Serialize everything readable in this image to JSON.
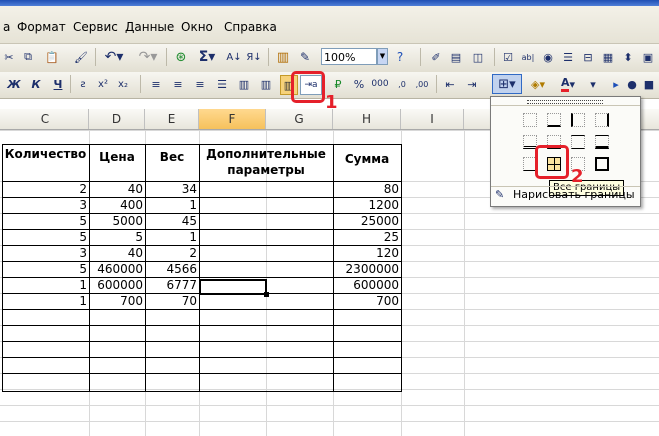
{
  "menu": {
    "items": [
      "Формат",
      "Сервис",
      "Данные",
      "Окно",
      "Справка"
    ]
  },
  "toolbar": {
    "zoom": "100%",
    "bold": "Ж",
    "italic": "К",
    "underline": "Ч",
    "sum": "Σ",
    "percent": "%",
    "font_color_letter": "A"
  },
  "columns": [
    "C",
    "D",
    "E",
    "F",
    "G",
    "H",
    "I"
  ],
  "selected_column": "F",
  "table": {
    "headers": {
      "quantity": "Количество",
      "price": "Цена",
      "weight": "Вес",
      "extra": "Дополнительные параметры",
      "sum": "Сумма"
    },
    "rows": [
      {
        "quantity": "2",
        "price": "40",
        "weight": "34",
        "sum": "80"
      },
      {
        "quantity": "3",
        "price": "400",
        "weight": "1",
        "sum": "1200"
      },
      {
        "quantity": "5",
        "price": "5000",
        "weight": "45",
        "sum": "25000"
      },
      {
        "quantity": "5",
        "price": "5",
        "weight": "1",
        "sum": "25"
      },
      {
        "quantity": "3",
        "price": "40",
        "weight": "2",
        "sum": "120"
      },
      {
        "quantity": "5",
        "price": "460000",
        "weight": "4566",
        "sum": "2300000"
      },
      {
        "quantity": "1",
        "price": "600000",
        "weight": "6777",
        "sum": "600000"
      },
      {
        "quantity": "1",
        "price": "700",
        "weight": "70",
        "sum": "700"
      }
    ]
  },
  "borders_menu": {
    "tooltip": "Все границы",
    "draw_borders": "Нарисовать границы"
  },
  "annotations": {
    "step1": "1",
    "step2": "2"
  },
  "colors": {
    "annotation_red": "#e5202a",
    "selected_column": "#f6c15c"
  }
}
